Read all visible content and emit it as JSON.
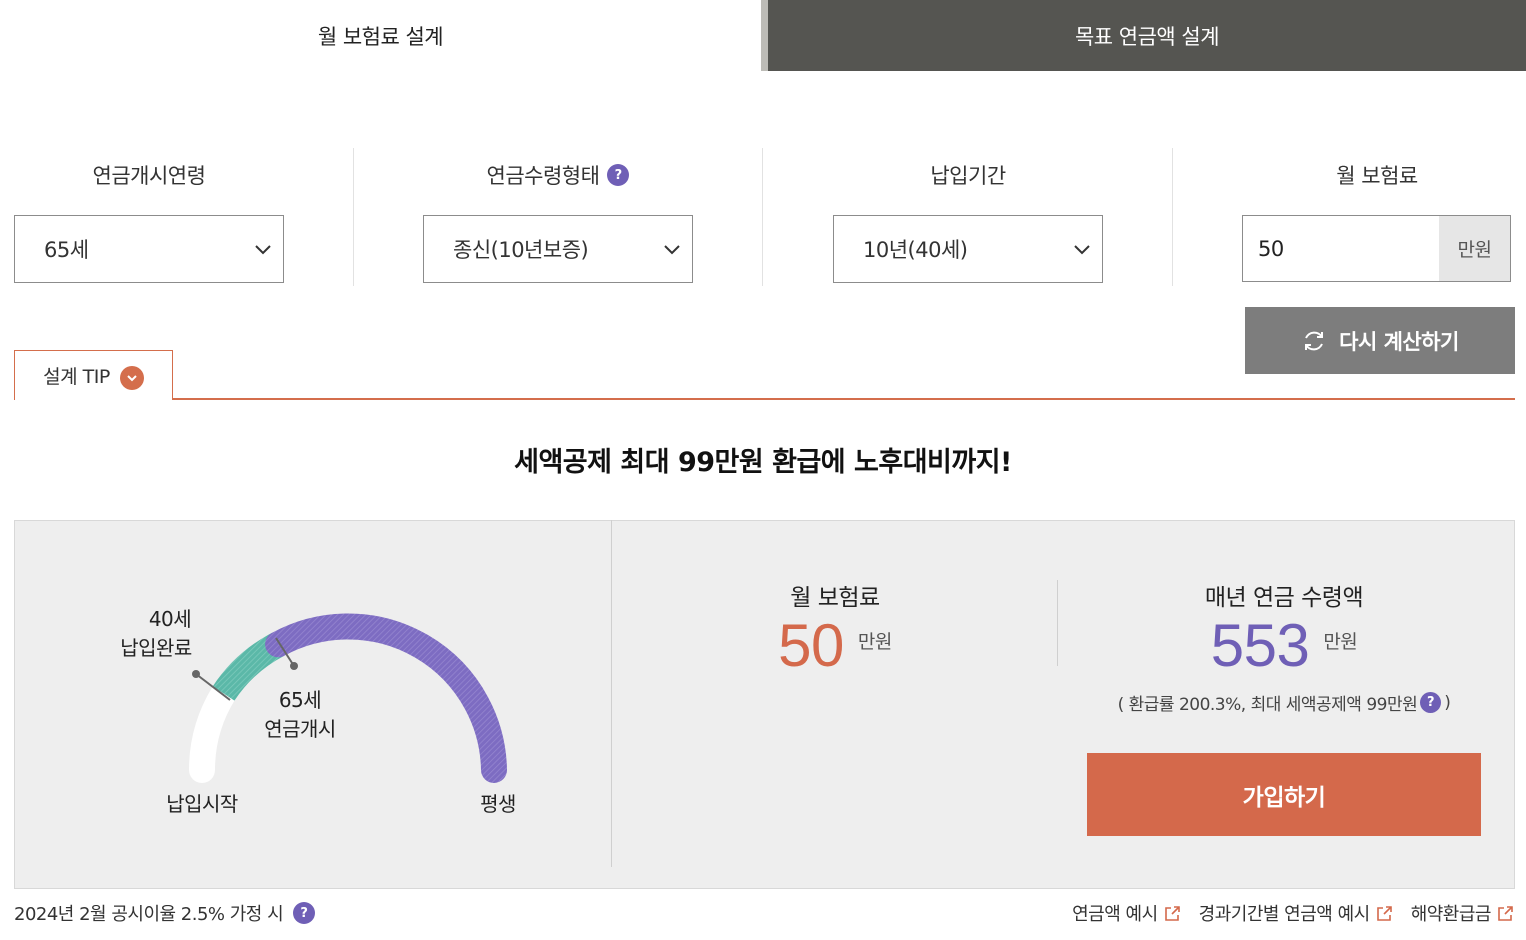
{
  "tabs": [
    {
      "label": "월 보험료 설계",
      "active": true
    },
    {
      "label": "목표 연금액 설계",
      "active": false
    }
  ],
  "form": {
    "start_age": {
      "label": "연금개시연령",
      "value": "65세"
    },
    "payout_type": {
      "label": "연금수령형태",
      "value": "종신(10년보증)",
      "help": "?"
    },
    "pay_period": {
      "label": "납입기간",
      "value": "10년(40세)"
    },
    "monthly_premium": {
      "label": "월 보험료",
      "value": "50",
      "unit": "만원"
    },
    "recalc_label": "다시 계산하기"
  },
  "tip": {
    "label": "설계 TIP"
  },
  "headline": "세액공제 최대 99만원 환급에 노후대비까지!",
  "gauge": {
    "start_label": "납입시작",
    "end_label": "평생",
    "pay_end_age": "40세",
    "pay_end_label": "납입완료",
    "annuity_age": "65세",
    "annuity_label": "연금개시"
  },
  "result": {
    "premium_title": "월 보험료",
    "premium_value": "50",
    "premium_unit": "만원",
    "annual_title": "매년 연금 수령액",
    "annual_value": "553",
    "annual_unit": "만원",
    "ratio_text": "( 환급률 200.3%, 최대 세액공제액 99만원",
    "ratio_close": ")",
    "join_label": "가입하기"
  },
  "footer": {
    "note": "2024년 2월 공시이율 2.5% 가정 시",
    "links": [
      "연금액 예시",
      "경과기간별 연금액 예시",
      "해약환급금"
    ]
  },
  "colors": {
    "accent_orange": "#d4694b",
    "accent_purple": "#6f5fb6",
    "gauge_teal": "#5bb8a8",
    "dark_tab": "#555551"
  }
}
